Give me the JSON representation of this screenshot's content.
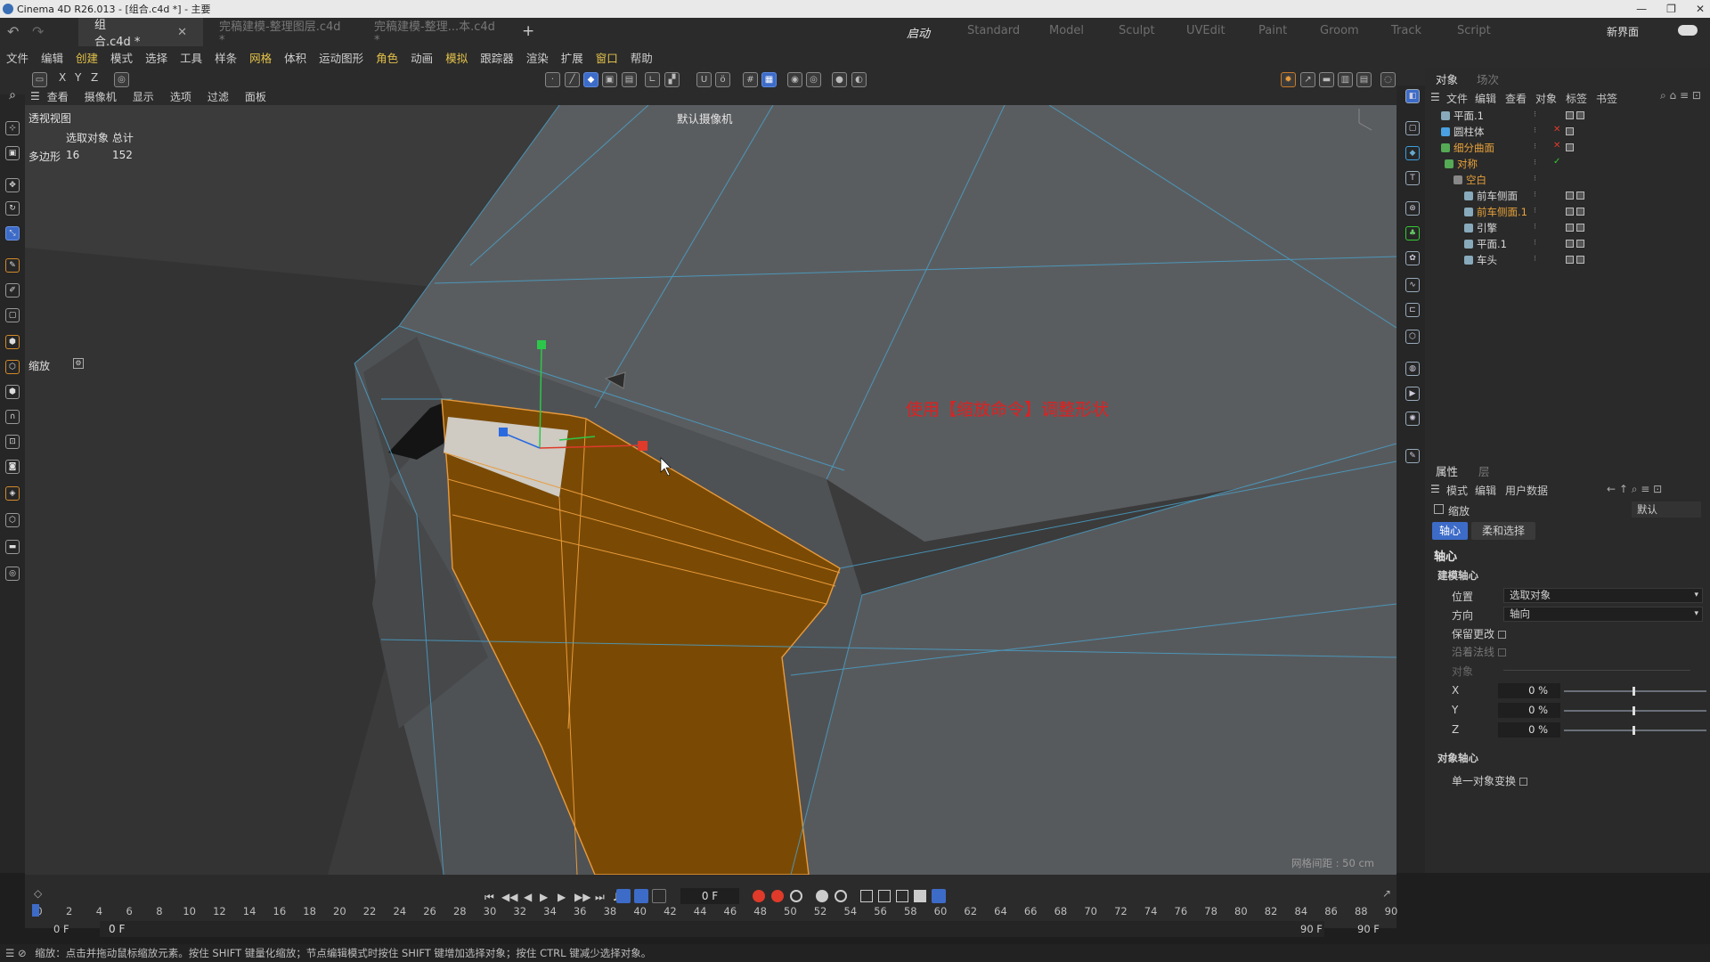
{
  "window": {
    "title": "Cinema 4D R26.013 - [组合.c4d *] - 主要",
    "controls": [
      "—",
      "❐",
      "✕"
    ]
  },
  "doc_tabs": [
    {
      "label": "组合.c4d *",
      "active": true
    },
    {
      "label": "完稿建模-整理图层.c4d *",
      "active": false
    },
    {
      "label": "完稿建模-整理...本.c4d *",
      "active": false
    }
  ],
  "layout_tabs": [
    "启动",
    "Standard",
    "Model",
    "Sculpt",
    "UVEdit",
    "Paint",
    "Groom",
    "Track",
    "Script"
  ],
  "layout_new": "新界面",
  "menu": [
    "文件",
    "编辑",
    "创建",
    "模式",
    "选择",
    "工具",
    "样条",
    "网格",
    "体积",
    "运动图形",
    "角色",
    "动画",
    "模拟",
    "跟踪器",
    "渲染",
    "扩展",
    "窗口",
    "帮助"
  ],
  "coord_toggles": [
    "X",
    "Y",
    "Z"
  ],
  "viewport_menu": [
    "查看",
    "摄像机",
    "显示",
    "选项",
    "过滤",
    "面板"
  ],
  "viewport": {
    "view_name": "透视视图",
    "camera": "默认摄像机",
    "stats_header": "选取对象 总计",
    "stats_label": "多边形",
    "stats_selected": "16",
    "stats_total": "152",
    "tool_label": "缩放",
    "annotation": "使用【缩放命令】调整形状",
    "grid_distance": "网格间距 : 50 cm",
    "selection_color": "#7a4a05",
    "wire_color": "#4aa0c8"
  },
  "object_panel": {
    "tabs": [
      "对象",
      "场次"
    ],
    "menu": [
      "文件",
      "编辑",
      "查看",
      "对象",
      "标签",
      "书签"
    ],
    "objects": [
      {
        "name": "平面.1",
        "level": 0,
        "color": "plain"
      },
      {
        "name": "圆柱体",
        "level": 0,
        "color": "plain"
      },
      {
        "name": "细分曲面",
        "level": 0,
        "color": "orange"
      },
      {
        "name": "对称",
        "level": 1,
        "color": "orange"
      },
      {
        "name": "空白",
        "level": 2,
        "color": "orange"
      },
      {
        "name": "前车侧面",
        "level": 3,
        "color": "plain"
      },
      {
        "name": "前车侧面.1",
        "level": 3,
        "color": "orange"
      },
      {
        "name": "引擎",
        "level": 3,
        "color": "plain"
      },
      {
        "name": "平面.1",
        "level": 3,
        "color": "plain"
      },
      {
        "name": "车头",
        "level": 3,
        "color": "plain"
      }
    ]
  },
  "attr_panel": {
    "tabs": [
      "属性",
      "层"
    ],
    "menu": [
      "模式",
      "编辑",
      "用户数据"
    ],
    "tool": "缩放",
    "preset": "默认",
    "subtabs": [
      "轴心",
      "柔和选择"
    ],
    "section": "轴心",
    "group1": "建模轴心",
    "position_label": "位置",
    "position_value": "选取对象",
    "orientation_label": "方向",
    "orientation_value": "轴向",
    "keep_changes": "保留更改",
    "along_normals": "沿着法线",
    "object_label": "对象",
    "axes": [
      {
        "label": "X",
        "value": "0 %"
      },
      {
        "label": "Y",
        "value": "0 %"
      },
      {
        "label": "Z",
        "value": "0 %"
      }
    ],
    "group2": "对象轴心",
    "single_object": "单一对象变换"
  },
  "timeline": {
    "current_frame": "0 F",
    "ticks": [
      "0",
      "2",
      "4",
      "6",
      "8",
      "10",
      "12",
      "14",
      "16",
      "18",
      "20",
      "22",
      "24",
      "26",
      "28",
      "30",
      "32",
      "34",
      "36",
      "38",
      "40",
      "42",
      "44",
      "46",
      "48",
      "50",
      "52",
      "54",
      "56",
      "58",
      "60",
      "62",
      "64",
      "66",
      "68",
      "70",
      "72",
      "74",
      "76",
      "78",
      "80",
      "82",
      "84",
      "86",
      "88",
      "90"
    ],
    "start": "0 F",
    "start2": "0 F",
    "end": "90 F",
    "end2": "90 F"
  },
  "status": "缩放：点击并拖动鼠标缩放元素。按住 SHIFT 键量化缩放；节点编辑模式时按住 SHIFT 键增加选择对象；按住 CTRL 键减少选择对象。"
}
